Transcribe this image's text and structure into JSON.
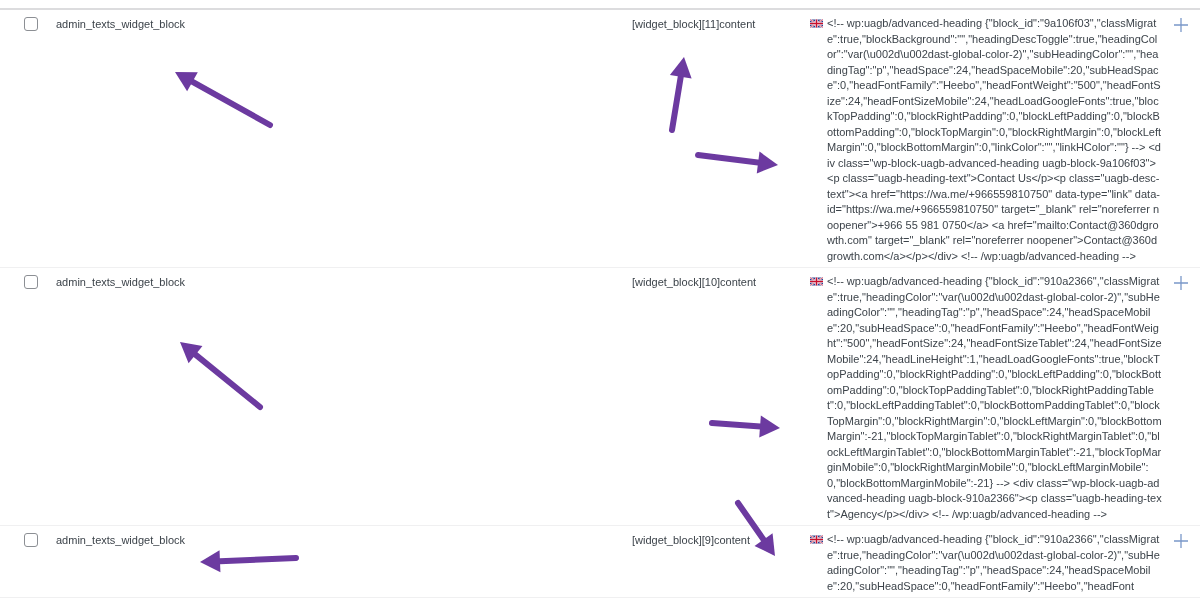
{
  "rows": [
    {
      "checked": false,
      "domain": "admin_texts_widget_block",
      "name": "[widget_block][11]content",
      "string": "<!-- wp:uagb/advanced-heading {\"block_id\":\"9a106f03\",\"classMigrate\":true,\"blockBackground\":\"\",\"headingDescToggle\":true,\"headingColor\":\"var(\\u002d\\u002dast-global-color-2)\",\"subHeadingColor\":\"\",\"headingTag\":\"p\",\"headSpace\":24,\"headSpaceMobile\":20,\"subHeadSpace\":0,\"headFontFamily\":\"Heebo\",\"headFontWeight\":\"500\",\"headFontSize\":24,\"headFontSizeMobile\":24,\"headLoadGoogleFonts\":true,\"blockTopPadding\":0,\"blockRightPadding\":0,\"blockLeftPadding\":0,\"blockBottomPadding\":0,\"blockTopMargin\":0,\"blockRightMargin\":0,\"blockLeftMargin\":0,\"blockBottomMargin\":0,\"linkColor\":\"\",\"linkHColor\":\"\"} --> <div class=\"wp-block-uagb-advanced-heading uagb-block-9a106f03\"><p class=\"uagb-heading-text\">Contact Us</p><p class=\"uagb-desc-text\"><a href=\"https://wa.me/+966559810750\" data-type=\"link\" data-id=\"https://wa.me/+966559810750\" target=\"_blank\" rel=\"noreferrer noopener\">+966 55 981 0750</a> <a href=\"mailto:Contact@360dgrowth.com\" target=\"_blank\" rel=\"noreferrer noopener\">Contact@360dgrowth.com</a></p></div> <!-- /wp:uagb/advanced-heading -->"
    },
    {
      "checked": false,
      "domain": "admin_texts_widget_block",
      "name": "[widget_block][10]content",
      "string": "<!-- wp:uagb/advanced-heading {\"block_id\":\"910a2366\",\"classMigrate\":true,\"headingColor\":\"var(\\u002d\\u002dast-global-color-2)\",\"subHeadingColor\":\"\",\"headingTag\":\"p\",\"headSpace\":24,\"headSpaceMobile\":20,\"subHeadSpace\":0,\"headFontFamily\":\"Heebo\",\"headFontWeight\":\"500\",\"headFontSize\":24,\"headFontSizeTablet\":24,\"headFontSizeMobile\":24,\"headLineHeight\":1,\"headLoadGoogleFonts\":true,\"blockTopPadding\":0,\"blockRightPadding\":0,\"blockLeftPadding\":0,\"blockBottomPadding\":0,\"blockTopPaddingTablet\":0,\"blockRightPaddingTablet\":0,\"blockLeftPaddingTablet\":0,\"blockBottomPaddingTablet\":0,\"blockTopMargin\":0,\"blockRightMargin\":0,\"blockLeftMargin\":0,\"blockBottomMargin\":-21,\"blockTopMarginTablet\":0,\"blockRightMarginTablet\":0,\"blockLeftMarginTablet\":0,\"blockBottomMarginTablet\":-21,\"blockTopMarginMobile\":0,\"blockRightMarginMobile\":0,\"blockLeftMarginMobile\":0,\"blockBottomMarginMobile\":-21} --> <div class=\"wp-block-uagb-advanced-heading uagb-block-910a2366\"><p class=\"uagb-heading-text\">Agency</p></div> <!-- /wp:uagb/advanced-heading -->"
    },
    {
      "checked": false,
      "domain": "admin_texts_widget_block",
      "name": "[widget_block][9]content",
      "string": "<!-- wp:uagb/advanced-heading {\"block_id\":\"910a2366\",\"classMigrate\":true,\"headingColor\":\"var(\\u002d\\u002dast-global-color-2)\",\"subHeadingColor\":\"\",\"headingTag\":\"p\",\"headSpace\":24,\"headSpaceMobile\":20,\"subHeadSpace\":0,\"headFontFamily\":\"Heebo\",\"headFont"
    }
  ]
}
